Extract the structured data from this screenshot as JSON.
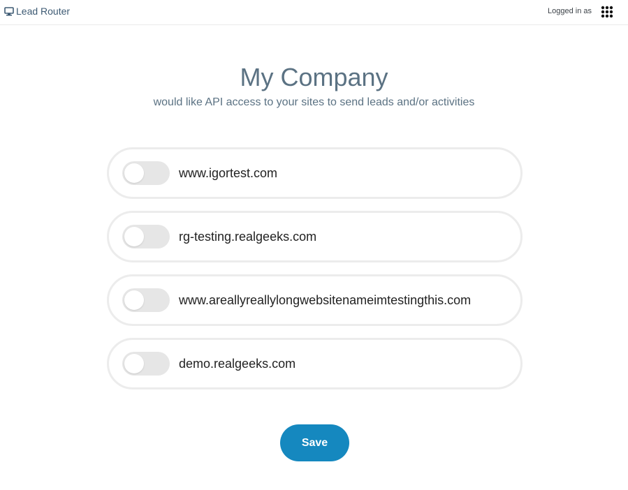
{
  "nav": {
    "brand": "Lead Router",
    "brand_icon": "monitor-icon",
    "logged_in_label": "Logged in as",
    "apps_icon": "grid-dots-icon"
  },
  "header": {
    "title": "My Company",
    "subtitle": "would like API access to your sites to send leads and/or activities"
  },
  "sites": [
    {
      "name": "www.igortest.com",
      "enabled": false
    },
    {
      "name": "rg-testing.realgeeks.com",
      "enabled": false
    },
    {
      "name": "www.areallyreallylongwebsitenameimtestingthis.com",
      "enabled": false
    },
    {
      "name": "demo.realgeeks.com",
      "enabled": false
    }
  ],
  "actions": {
    "save_label": "Save"
  },
  "colors": {
    "accent": "#1588bf",
    "heading": "#5b7283",
    "brand": "#3d5a73",
    "toggle_off": "#e6e6e6",
    "row_border": "#ececec"
  }
}
